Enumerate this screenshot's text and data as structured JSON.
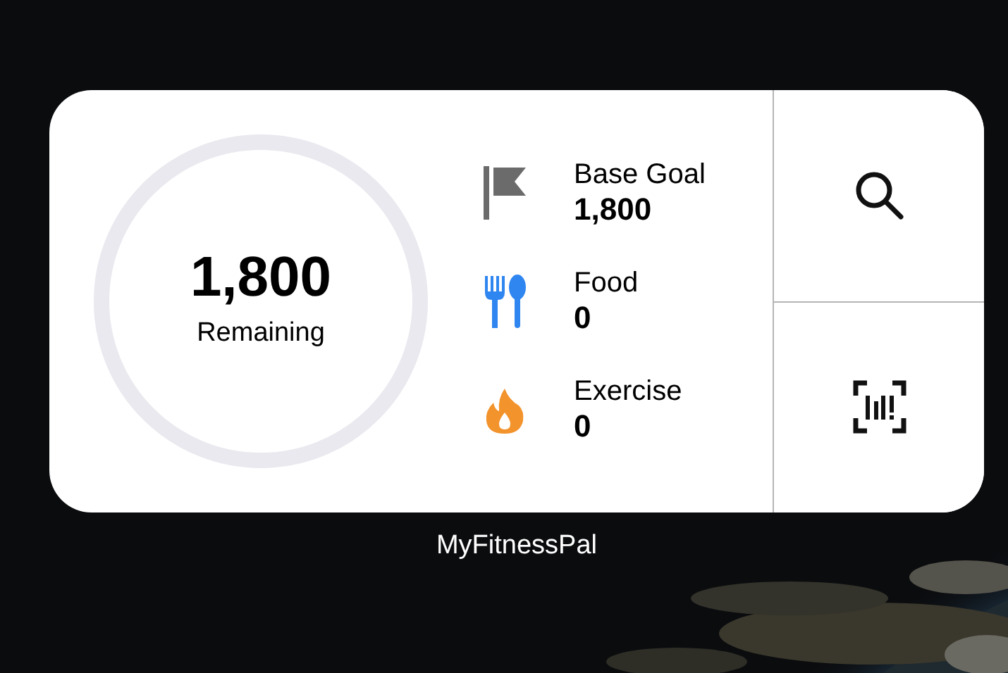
{
  "widget": {
    "ring": {
      "value": "1,800",
      "label": "Remaining"
    },
    "stats": [
      {
        "kind": "goal",
        "label": "Base Goal",
        "value": "1,800"
      },
      {
        "kind": "food",
        "label": "Food",
        "value": "0"
      },
      {
        "kind": "exercise",
        "label": "Exercise",
        "value": "0"
      }
    ],
    "actions": [
      {
        "kind": "search"
      },
      {
        "kind": "barcode"
      }
    ]
  },
  "app_name": "MyFitnessPal"
}
